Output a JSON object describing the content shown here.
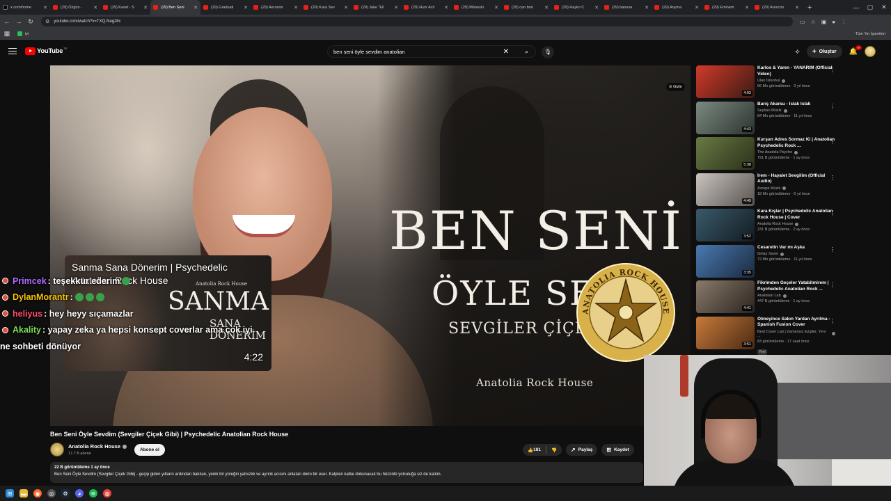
{
  "browser": {
    "tabs": [
      {
        "label": "x.com/home",
        "kind": "x"
      },
      {
        "label": "(29) Özgün - ",
        "kind": "yt"
      },
      {
        "label": "(29) Kaset - S",
        "kind": "yt"
      },
      {
        "label": "(29) Ben Seni",
        "kind": "yt",
        "active": true
      },
      {
        "label": "(29) Graduati",
        "kind": "yt"
      },
      {
        "label": "(29) Aerosmi",
        "kind": "yt"
      },
      {
        "label": "(29) Kara Sev",
        "kind": "yt"
      },
      {
        "label": "(29) Jake \"Ell",
        "kind": "yt"
      },
      {
        "label": "(29) Hızır Acil",
        "kind": "yt"
      },
      {
        "label": "(29) Mâneski",
        "kind": "yt"
      },
      {
        "label": "(29) can bon",
        "kind": "yt"
      },
      {
        "label": "(29) Hayko C",
        "kind": "yt"
      },
      {
        "label": "(29) baneva",
        "kind": "yt"
      },
      {
        "label": "(29) Anyma",
        "kind": "yt"
      },
      {
        "label": "(29) Eminem",
        "kind": "yt"
      },
      {
        "label": "(29) Arexcon",
        "kind": "yt"
      }
    ],
    "url": "youtube.com/watch?v=TXQ-Negz8c",
    "bookmark": "iyi",
    "bookmarks_right": "Tüm Yer İşaretleri"
  },
  "masthead": {
    "logo": "YouTube",
    "region": "TR",
    "search_value": "ben seni öyle sevdim anatolian",
    "create_label": "Oluştur",
    "notif_count": "9+"
  },
  "player": {
    "hide_label": "Gizle",
    "poster_line1": "BEN SENİ",
    "poster_line2": "ÖYLE SEVD",
    "poster_artist": "SEVGİLER ÇİÇEK G",
    "poster_band": "Anatolia Rock House",
    "emblem_text": "ANATOLIA ROCK HOUSE"
  },
  "chat": [
    {
      "user": "Primcek",
      "color": "#b06bff",
      "message": ": teşekkür ederim",
      "emotes": 1
    },
    {
      "user": "DylanMorantr",
      "color": "#f7c300",
      "message": ":",
      "emotes": 3
    },
    {
      "user": "heliyus",
      "color": "#ff4d6d",
      "message": ": hey heyy sıçamazlar",
      "emotes": 0
    },
    {
      "user": "Akality",
      "color": "#7ee05a",
      "message": ": yapay zeka ya hepsi konsept coverlar ama çok iyi",
      "emotes": 0
    },
    {
      "user": "",
      "color": "#ffffff",
      "message": "ne sohbeti dönüyor",
      "emotes": 0,
      "nodot": true
    }
  ],
  "miniplayer": {
    "title": "Sanma Sana Dönerim | Psychedelic Anatolian Rock House",
    "label": "Anatolia Rock House",
    "text_big": "SANMA",
    "text_small1": "SANA",
    "text_small2": "DÖNERİM",
    "duration": "4:22"
  },
  "video": {
    "title": "Ben Seni Öyle Sevdim (Sevgiler Çiçek Gibi) | Psychedelic Anatolian Rock House",
    "channel": "Anatolia Rock House",
    "subscribers": "17,7 B abone",
    "subscribe_label": "Abone ol",
    "likes": "181",
    "share_label": "Paylaş",
    "save_label": "Kaydet",
    "views_date": "22 B görüntüleme  1 ay önce",
    "description": "Ben Seni Öyle Sevdim (Sevgiler Çiçek Gibi) - geçip giden yılların ardından bakılan, yenik bir yüreğin yalnızlık ve ayrılık acısını anlatan derin bir eser. Kalpten kalbe dokunacak bu hüzünlü yolculuğa siz de katılın."
  },
  "recommendations": [
    {
      "title": "Karlos & Yaren - YANARIM (Official Video)",
      "channel": "Ulan İstanbul",
      "meta": "56 Mn görüntüleme · 3 yıl önce",
      "duration": "4:03",
      "c1": "#d23a2a",
      "c2": "#3a1a14"
    },
    {
      "title": "Barış Akarsu - Islak Islak",
      "channel": "Seyhan Müzik",
      "meta": "84 Mn görüntüleme · 11 yıl önce",
      "duration": "4:43",
      "c1": "#7c8a80",
      "c2": "#2a3430"
    },
    {
      "title": "Kurşun Adres Sormaz Ki | Anatolian Psychedelic Rock ...",
      "channel": "The Anatolia Psyche",
      "meta": "791 B görüntüleme · 1 ay önce",
      "duration": "5:38",
      "c1": "#6a7a45",
      "c2": "#2a3018"
    },
    {
      "title": "İrem - Hayalet Sevgilim (Official Audio)",
      "channel": "Avrupa Müzik",
      "meta": "18 Mn görüntüleme · 6 yıl önce",
      "duration": "4:49",
      "c1": "#c9c4c0",
      "c2": "#5a5450"
    },
    {
      "title": "Kara Kışlar | Psychedelic Anatolian Rock House | Cover",
      "channel": "Anatolia Rock House",
      "meta": "231 B görüntüleme · 2 ay önce",
      "duration": "3:52",
      "c1": "#3a5a6a",
      "c2": "#121c22"
    },
    {
      "title": "Cesaretin Var mı Aşka",
      "channel": "Gülay Sezer",
      "meta": "72 Mn görüntüleme · 11 yıl önce",
      "duration": "3:35",
      "c1": "#4a7ab0",
      "c2": "#1a2a40"
    },
    {
      "title": "Fikrimden Geçeler Yatabilmirem | Psychedelic Anatolian Rock ...",
      "channel": "Anatolian Lab",
      "meta": "447 B görüntüleme · 1 ay önce",
      "duration": "4:41",
      "c1": "#8a7a6a",
      "c2": "#2a2420"
    },
    {
      "title": "Ölmeyince Sakın Yardan Ayrılma - Spanish Fusion Cover",
      "channel": "Best Cover Lab | Zamansız Ezgiler, Yeni ...",
      "meta": "83 görüntüleme · 17 saat önce",
      "duration": "3:51",
      "c1": "#c87a3a",
      "c2": "#4a2a14",
      "new": "Yeni"
    }
  ]
}
